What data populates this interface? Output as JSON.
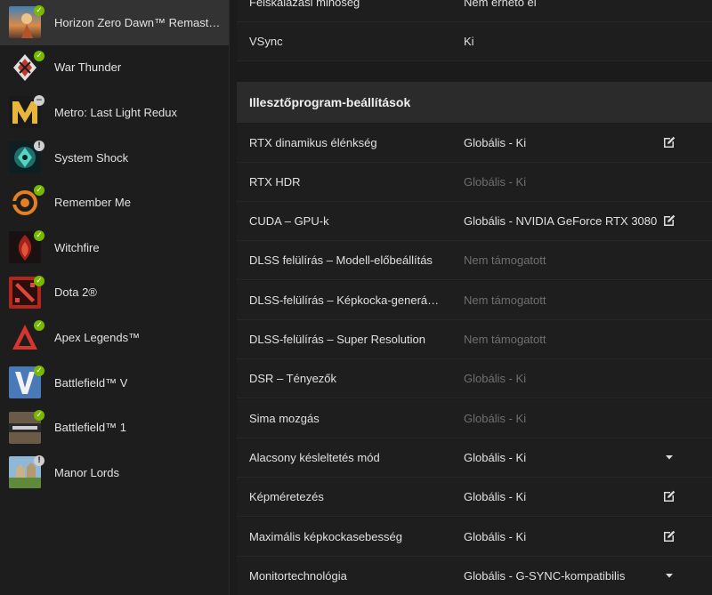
{
  "sidebar": {
    "games": [
      {
        "name": "Horizon Zero Dawn™ Remastered",
        "status": "ok",
        "selected": true,
        "thumb": "horizon"
      },
      {
        "name": "War Thunder",
        "status": "ok",
        "selected": false,
        "thumb": "warthunder"
      },
      {
        "name": "Metro: Last Light Redux",
        "status": "minus",
        "selected": false,
        "thumb": "metro"
      },
      {
        "name": "System Shock",
        "status": "warn",
        "selected": false,
        "thumb": "systemshock"
      },
      {
        "name": "Remember Me",
        "status": "ok",
        "selected": false,
        "thumb": "rememberme"
      },
      {
        "name": "Witchfire",
        "status": "ok",
        "selected": false,
        "thumb": "witchfire"
      },
      {
        "name": "Dota 2®",
        "status": "ok",
        "selected": false,
        "thumb": "dota"
      },
      {
        "name": "Apex Legends™",
        "status": "ok",
        "selected": false,
        "thumb": "apex"
      },
      {
        "name": "Battlefield™ V",
        "status": "ok",
        "selected": false,
        "thumb": "bfv"
      },
      {
        "name": "Battlefield™ 1",
        "status": "ok",
        "selected": false,
        "thumb": "bf1"
      },
      {
        "name": "Manor Lords",
        "status": "warn",
        "selected": false,
        "thumb": "manorlords"
      }
    ]
  },
  "top_rows": [
    {
      "label": "Felskálázási minőség",
      "value": "Nem érhető el",
      "dim": false,
      "action": ""
    },
    {
      "label": "VSync",
      "value": "Ki",
      "dim": false,
      "action": ""
    }
  ],
  "section": {
    "title": "Illesztőprogram-beállítások",
    "rows": [
      {
        "label": "RTX dinamikus élénkség",
        "value": "Globális - Ki",
        "dim": false,
        "action": "edit"
      },
      {
        "label": "RTX HDR",
        "value": "Globális - Ki",
        "dim": true,
        "action": ""
      },
      {
        "label": "CUDA – GPU-k",
        "value": "Globális - NVIDIA GeForce RTX 3080",
        "dim": false,
        "action": "edit"
      },
      {
        "label": "DLSS felülírás – Modell-előbeállítás",
        "value": "Nem támogatott",
        "dim": true,
        "action": ""
      },
      {
        "label": "DLSS-felülírás – Képkocka-generálás",
        "value": "Nem támogatott",
        "dim": true,
        "action": ""
      },
      {
        "label": "DLSS-felülírás – Super Resolution",
        "value": "Nem támogatott",
        "dim": true,
        "action": ""
      },
      {
        "label": "DSR – Tényezők",
        "value": "Globális - Ki",
        "dim": true,
        "action": ""
      },
      {
        "label": "Sima mozgás",
        "value": "Globális - Ki",
        "dim": true,
        "action": ""
      },
      {
        "label": "Alacsony késleltetés mód",
        "value": "Globális - Ki",
        "dim": false,
        "action": "dropdown"
      },
      {
        "label": "Képméretezés",
        "value": "Globális - Ki",
        "dim": false,
        "action": "edit"
      },
      {
        "label": "Maximális képkockasebesség",
        "value": "Globális - Ki",
        "dim": false,
        "action": "edit"
      },
      {
        "label": "Monitortechnológia",
        "value": "Globális - G-SYNC-kompatibilis",
        "dim": false,
        "action": "dropdown"
      }
    ]
  },
  "colors": {
    "accent": "#76b900",
    "background": "#1b1b1b",
    "selected": "#333333",
    "section_header": "#2b2b2b"
  },
  "icons": {
    "edit": "edit-icon",
    "dropdown": "chevron-down-icon",
    "ok": "check-icon",
    "minus": "minus-icon",
    "warn": "exclamation-icon"
  }
}
